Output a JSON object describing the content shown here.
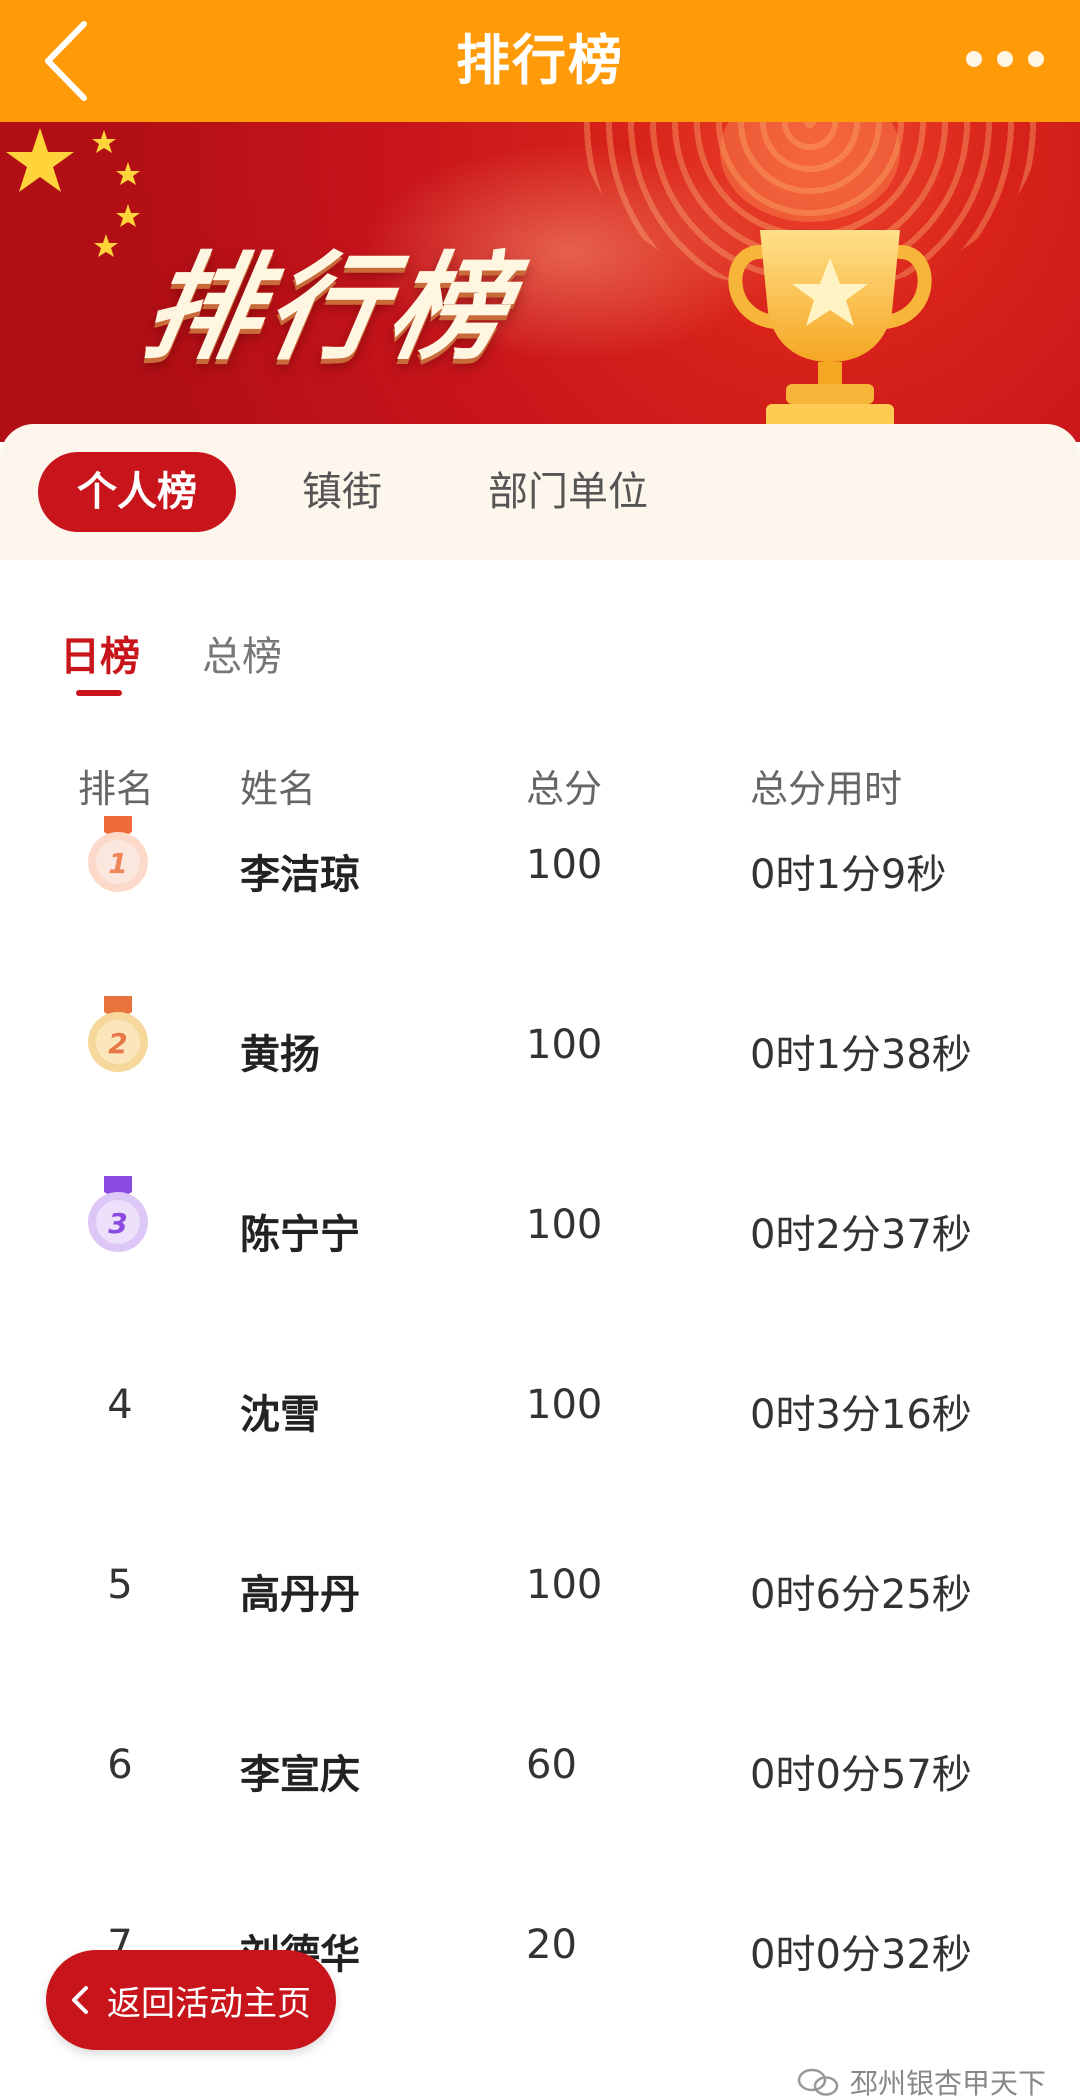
{
  "header": {
    "title": "排行榜",
    "back_icon": "chevron-left-icon",
    "more_icon": "more-dots-icon",
    "bg_color": "#FF9A09"
  },
  "banner": {
    "title": "排行榜",
    "trophy_icon": "trophy-icon"
  },
  "category_tabs": [
    {
      "label": "个人榜",
      "active": true
    },
    {
      "label": "镇街",
      "active": false
    },
    {
      "label": "部门单位",
      "active": false
    }
  ],
  "sub_tabs": [
    {
      "label": "日榜",
      "active": true
    },
    {
      "label": "总榜",
      "active": false
    }
  ],
  "table": {
    "headers": [
      "排名",
      "姓名",
      "总分",
      "总分用时"
    ],
    "rows": [
      {
        "rank": "1",
        "name": "李洁琼",
        "score": "100",
        "time": "0时1分9秒"
      },
      {
        "rank": "2",
        "name": "黄扬",
        "score": "100",
        "time": "0时1分38秒"
      },
      {
        "rank": "3",
        "name": "陈宁宁",
        "score": "100",
        "time": "0时2分37秒"
      },
      {
        "rank": "4",
        "name": "沈雪",
        "score": "100",
        "time": "0时3分16秒"
      },
      {
        "rank": "5",
        "name": "高丹丹",
        "score": "100",
        "time": "0时6分25秒"
      },
      {
        "rank": "6",
        "name": "李宣庆",
        "score": "60",
        "time": "0时0分57秒"
      },
      {
        "rank": "7",
        "name": "刘德华",
        "score": "20",
        "time": "0时0分32秒"
      }
    ]
  },
  "footer": {
    "home_button_label": "返回活动主页",
    "watermark": "邳州银杏甲天下"
  },
  "colors": {
    "accent": "#C8151B",
    "topbar": "#FF9A09",
    "tab_bar_bg": "#FCF6EC"
  }
}
